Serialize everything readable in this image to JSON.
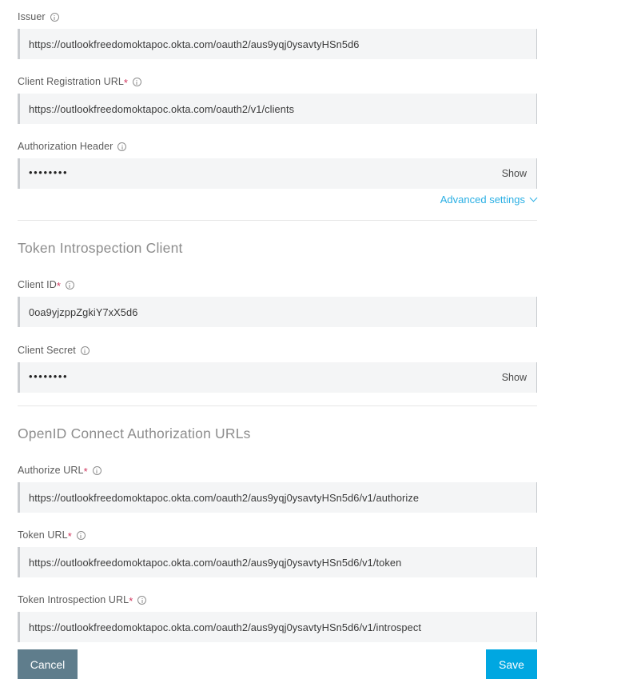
{
  "form": {
    "fields": [
      {
        "label": "Issuer",
        "required": false,
        "info_icon": "info-icon",
        "type": "text",
        "value": "https://outlookfreedomoktapoc.okta.com/oauth2/aus9yqj0ysavtyHSn5d6",
        "name": "issuer"
      },
      {
        "label": "Client Registration URL",
        "required": true,
        "info_icon": "info-icon",
        "type": "text",
        "value": "https://outlookfreedomoktapoc.okta.com/oauth2/v1/clients",
        "name": "client-registration-url"
      },
      {
        "label": "Authorization Header",
        "required": false,
        "info_icon": "info-icon",
        "type": "password",
        "value": "••••••••",
        "show_label": "Show",
        "name": "authorization-header"
      }
    ],
    "advanced_settings": {
      "label": "Advanced settings",
      "chevron_icon": "chevron-down-icon"
    },
    "sections": [
      {
        "title": "Token Introspection Client",
        "name": "token-introspection-client",
        "fields": [
          {
            "label": "Client ID",
            "required": true,
            "info_icon": "info-icon",
            "type": "text",
            "value": "0oa9yjzppZgkiY7xX5d6",
            "name": "client-id"
          },
          {
            "label": "Client Secret",
            "required": false,
            "info_icon": "info-icon",
            "type": "password",
            "value": "••••••••",
            "show_label": "Show",
            "name": "client-secret"
          }
        ]
      },
      {
        "title": "OpenID Connect Authorization URLs",
        "name": "openid-connect-authorization-urls",
        "fields": [
          {
            "label": "Authorize URL",
            "required": true,
            "info_icon": "info-icon",
            "type": "text",
            "value": "https://outlookfreedomoktapoc.okta.com/oauth2/aus9yqj0ysavtyHSn5d6/v1/authorize",
            "name": "authorize-url"
          },
          {
            "label": "Token URL",
            "required": true,
            "info_icon": "info-icon",
            "type": "text",
            "value": "https://outlookfreedomoktapoc.okta.com/oauth2/aus9yqj0ysavtyHSn5d6/v1/token",
            "name": "token-url"
          },
          {
            "label": "Token Introspection URL",
            "required": true,
            "info_icon": "info-icon",
            "type": "text",
            "value": "https://outlookfreedomoktapoc.okta.com/oauth2/aus9yqj0ysavtyHSn5d6/v1/introspect",
            "name": "token-introspection-url"
          }
        ]
      }
    ]
  },
  "footer": {
    "cancel_label": "Cancel",
    "save_label": "Save"
  },
  "colors": {
    "save_button": "#00a7e1",
    "cancel_button": "#5f7d8c",
    "link": "#2aafe4",
    "required_asterisk": "#d0365e",
    "input_background": "#f4f5f6",
    "section_title": "#8d8d8d"
  }
}
